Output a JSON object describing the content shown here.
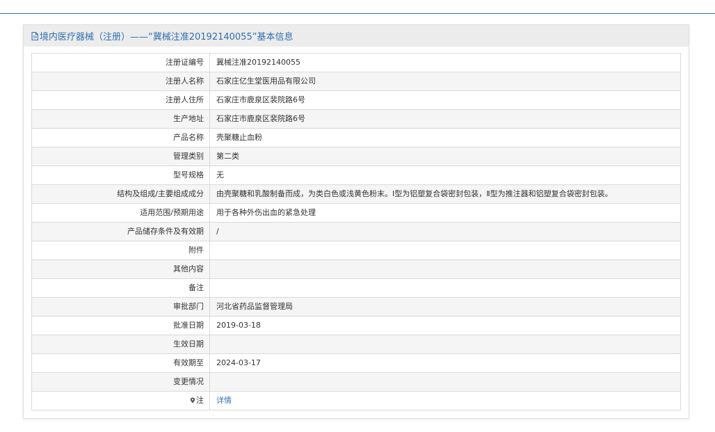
{
  "header": {
    "title": "境内医疗器械（注册）——“冀械注准20192140055”基本信息"
  },
  "rows": [
    {
      "label": "注册证编号",
      "value": "冀械注准20192140055"
    },
    {
      "label": "注册人名称",
      "value": "石家庄亿生堂医用品有限公司"
    },
    {
      "label": "注册人住所",
      "value": "石家庄市鹿泉区裴院路6号"
    },
    {
      "label": "生产地址",
      "value": "石家庄市鹿泉区裴院路6号"
    },
    {
      "label": "产品名称",
      "value": "壳聚糖止血粉"
    },
    {
      "label": "管理类别",
      "value": "第二类"
    },
    {
      "label": "型号规格",
      "value": "无"
    },
    {
      "label": "结构及组成/主要组成成分",
      "value": "由壳聚糖和乳酸制备而成，为类白色或浅黄色粉末。Ⅰ型为铝塑复合袋密封包装，Ⅱ型为推注器和铝塑复合袋密封包装。"
    },
    {
      "label": "适用范围/预期用途",
      "value": "用于各种外伤出血的紧急处理"
    },
    {
      "label": "产品储存条件及有效期",
      "value": "/"
    },
    {
      "label": "附件",
      "value": ""
    },
    {
      "label": "其他内容",
      "value": ""
    },
    {
      "label": "备注",
      "value": ""
    },
    {
      "label": "审批部门",
      "value": "河北省药品监督管理局"
    },
    {
      "label": "批准日期",
      "value": "2019-03-18"
    },
    {
      "label": "生效日期",
      "value": ""
    },
    {
      "label": "有效期至",
      "value": "2024-03-17"
    },
    {
      "label": "变更情况",
      "value": ""
    },
    {
      "label": "注",
      "value": "详情"
    }
  ]
}
